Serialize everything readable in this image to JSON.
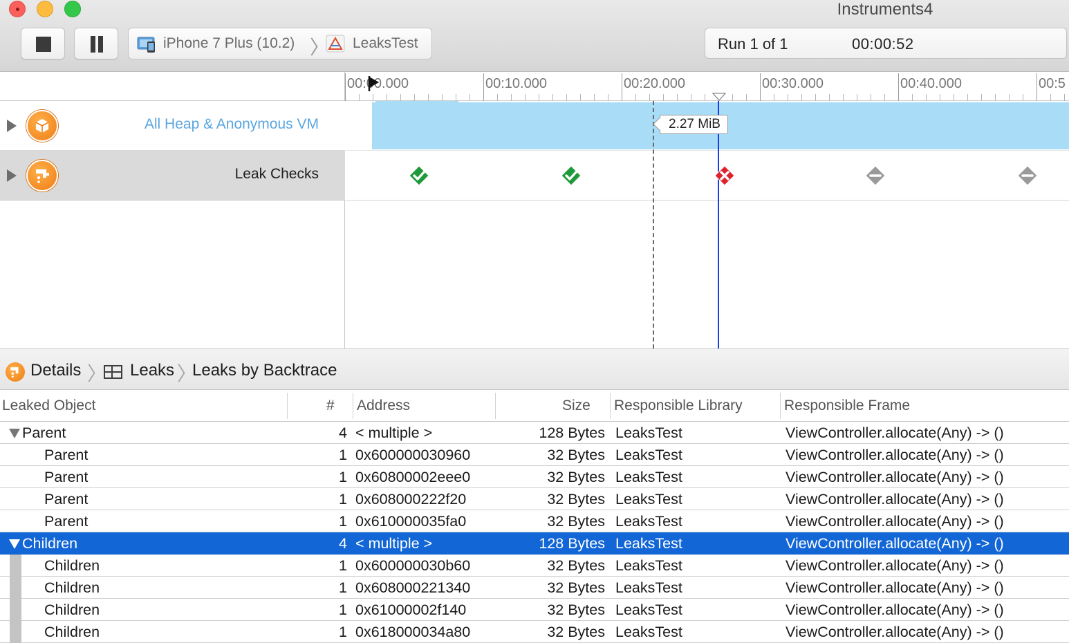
{
  "window": {
    "title": "Instruments4"
  },
  "toolbar": {
    "stop_icon": "stop-icon",
    "pause_icon": "pause-icon",
    "scheme_device": "iPhone 7 Plus (10.2)",
    "scheme_target": "LeaksTest",
    "run_label": "Run 1 of 1",
    "run_time": "00:00:52"
  },
  "ruler": {
    "ticks": [
      "00:00.000",
      "00:10.000",
      "00:20.000",
      "00:30.000",
      "00:40.000",
      "00:5"
    ]
  },
  "tracks": [
    {
      "name": "All Heap & Anonymous VM",
      "icon": "allocations-icon"
    },
    {
      "name": "Leak Checks",
      "icon": "leaks-icon"
    }
  ],
  "heap_tooltip": "2.27 MiB",
  "leak_checks": [
    {
      "status": "ok",
      "icon": "green-check-icon"
    },
    {
      "status": "ok",
      "icon": "green-check-icon"
    },
    {
      "status": "leak",
      "icon": "red-x-icon"
    },
    {
      "status": "pending",
      "icon": "gray-minus-icon"
    },
    {
      "status": "pending",
      "icon": "gray-minus-icon"
    }
  ],
  "colors": {
    "heap_fill": "#a8dcf7",
    "inspection_line": "#1a3fe0",
    "selection": "#1266d6",
    "check_ok": "#1f9a3a",
    "check_leak": "#e0202a",
    "check_pending": "#9a9a9a"
  },
  "jumpbar": {
    "details": "Details",
    "leaks": "Leaks",
    "view": "Leaks by Backtrace"
  },
  "table": {
    "columns": [
      "Leaked Object",
      "#",
      "Address",
      "Size",
      "Responsible Library",
      "Responsible Frame"
    ],
    "rows": [
      {
        "object": "Parent",
        "count": "4",
        "address": "< multiple >",
        "size": "128 Bytes",
        "library": "LeaksTest",
        "frame": "ViewController.allocate(Any) -> ()"
      },
      {
        "object": "Parent",
        "count": "1",
        "address": "0x600000030960",
        "size": "32 Bytes",
        "library": "LeaksTest",
        "frame": "ViewController.allocate(Any) -> ()"
      },
      {
        "object": "Parent",
        "count": "1",
        "address": "0x60800002eee0",
        "size": "32 Bytes",
        "library": "LeaksTest",
        "frame": "ViewController.allocate(Any) -> ()"
      },
      {
        "object": "Parent",
        "count": "1",
        "address": "0x608000222f20",
        "size": "32 Bytes",
        "library": "LeaksTest",
        "frame": "ViewController.allocate(Any) -> ()"
      },
      {
        "object": "Parent",
        "count": "1",
        "address": "0x610000035fa0",
        "size": "32 Bytes",
        "library": "LeaksTest",
        "frame": "ViewController.allocate(Any) -> ()"
      },
      {
        "object": "Children",
        "count": "4",
        "address": "< multiple >",
        "size": "128 Bytes",
        "library": "LeaksTest",
        "frame": "ViewController.allocate(Any) -> ()"
      },
      {
        "object": "Children",
        "count": "1",
        "address": "0x600000030b60",
        "size": "32 Bytes",
        "library": "LeaksTest",
        "frame": "ViewController.allocate(Any) -> ()"
      },
      {
        "object": "Children",
        "count": "1",
        "address": "0x608000221340",
        "size": "32 Bytes",
        "library": "LeaksTest",
        "frame": "ViewController.allocate(Any) -> ()"
      },
      {
        "object": "Children",
        "count": "1",
        "address": "0x61000002f140",
        "size": "32 Bytes",
        "library": "LeaksTest",
        "frame": "ViewController.allocate(Any) -> ()"
      },
      {
        "object": "Children",
        "count": "1",
        "address": "0x618000034a80",
        "size": "32 Bytes",
        "library": "LeaksTest",
        "frame": "ViewController.allocate(Any) -> ()"
      }
    ]
  }
}
